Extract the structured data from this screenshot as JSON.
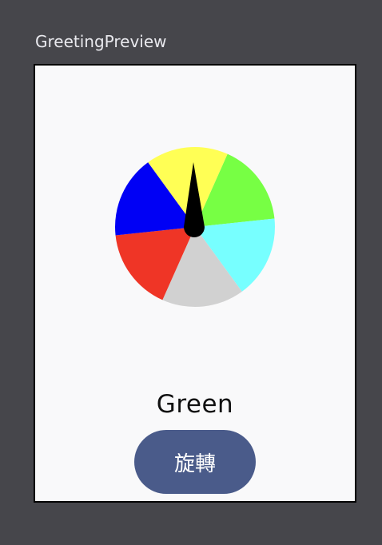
{
  "preview": {
    "title": "GreetingPreview"
  },
  "wheel": {
    "segments": [
      {
        "color": "#77ff44"
      },
      {
        "color": "#77ffff"
      },
      {
        "color": "#d1d1d1"
      },
      {
        "color": "#ef3526"
      },
      {
        "color": "#0000f5"
      },
      {
        "color": "#ffff55"
      }
    ],
    "pointer_color": "#000000"
  },
  "result": {
    "text": "Green"
  },
  "spin_button": {
    "label": "旋轉",
    "color": "#4a5b8a"
  }
}
